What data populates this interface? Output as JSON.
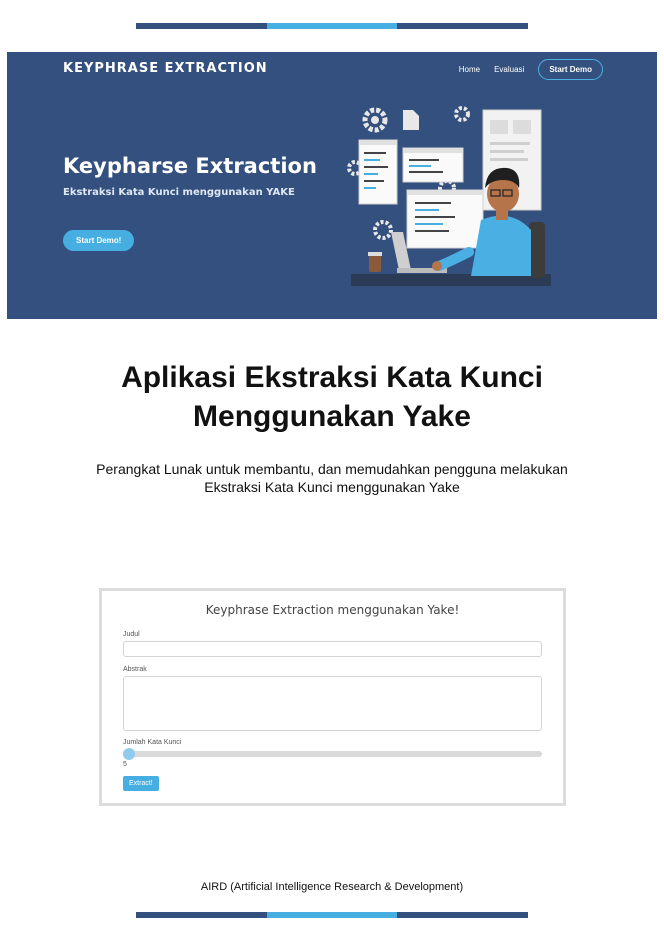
{
  "colors": {
    "navy": "#34507e",
    "accent": "#47aee2",
    "bar_dark": "#34507e",
    "bar_light": "#47aee2"
  },
  "hero": {
    "brand": "KEYPHRASE EXTRACTION",
    "nav": {
      "home": "Home",
      "evaluasi": "Evaluasi",
      "start_demo": "Start Demo"
    },
    "title": "Keypharse Extraction",
    "subtitle": "Ekstraksi Kata Kunci menggunakan YAKE",
    "button": "Start Demo!"
  },
  "heading": {
    "line1": "Aplikasi Ekstraksi Kata Kunci",
    "line2": "Menggunakan Yake"
  },
  "description": {
    "line1": "Perangkat Lunak untuk membantu, dan memudahkan pengguna melakukan",
    "line2": "Ekstraksi Kata Kunci menggunakan Yake"
  },
  "form": {
    "title": "Keyphrase Extraction menggunakan Yake!",
    "judul_label": "Judul",
    "judul_value": "",
    "abstrak_label": "Abstrak",
    "abstrak_value": "",
    "jumlah_label": "Jumlah Kata Kunci",
    "jumlah_value": "5",
    "extract_button": "Extract!"
  },
  "footer": "AIRD (Artificial Intelligence Research & Development)"
}
